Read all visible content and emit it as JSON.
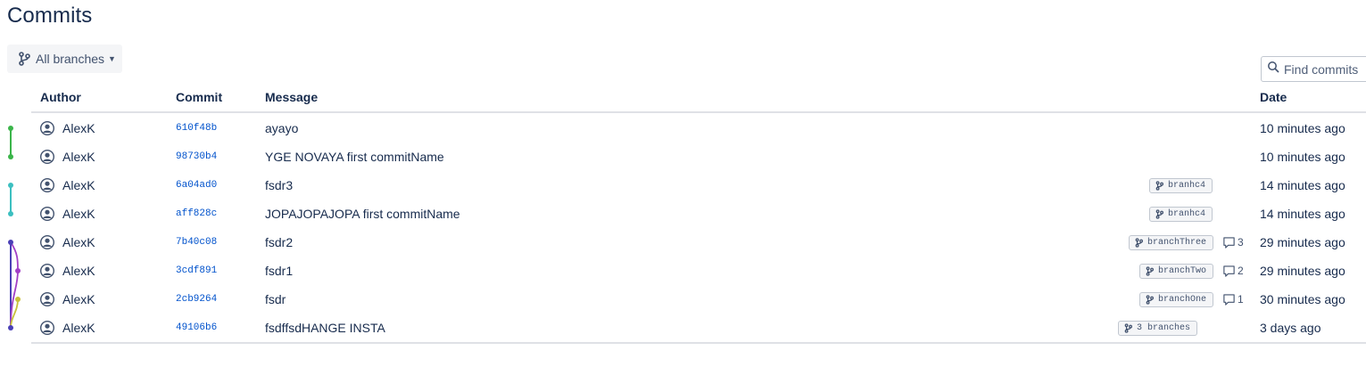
{
  "page": {
    "title": "Commits"
  },
  "toolbar": {
    "branch_selector": "All branches",
    "search_placeholder": "Find commits"
  },
  "table": {
    "headers": {
      "author": "Author",
      "commit": "Commit",
      "message": "Message",
      "date": "Date"
    },
    "rows": [
      {
        "author": "AlexK",
        "hash": "610f48b",
        "message": "ayayo",
        "tag": "",
        "comments": "",
        "date": "10 minutes ago"
      },
      {
        "author": "AlexK",
        "hash": "98730b4",
        "message": "YGE NOVAYA first commitName",
        "tag": "",
        "comments": "",
        "date": "10 minutes ago"
      },
      {
        "author": "AlexK",
        "hash": "6a04ad0",
        "message": "fsdr3",
        "tag": "branhc4",
        "comments": "",
        "date": "14 minutes ago"
      },
      {
        "author": "AlexK",
        "hash": "aff828c",
        "message": "JOPAJOPAJOPA first commitName",
        "tag": "branhc4",
        "comments": "",
        "date": "14 minutes ago"
      },
      {
        "author": "AlexK",
        "hash": "7b40c08",
        "message": "fsdr2",
        "tag": "branchThree",
        "comments": "3",
        "date": "29 minutes ago"
      },
      {
        "author": "AlexK",
        "hash": "3cdf891",
        "message": "fsdr1",
        "tag": "branchTwo",
        "comments": "2",
        "date": "29 minutes ago"
      },
      {
        "author": "AlexK",
        "hash": "2cb9264",
        "message": "fsdr",
        "tag": "branchOne",
        "comments": "1",
        "date": "30 minutes ago"
      },
      {
        "author": "AlexK",
        "hash": "49106b6",
        "message": "fsdffsdHANGE INSTA",
        "tag": "3 branches",
        "comments": "",
        "date": "3 days ago"
      }
    ]
  },
  "graph": {
    "colors": {
      "green": "#3bb54a",
      "teal": "#3cbfc0",
      "indigo": "#4a3fb6",
      "purple": "#a23fc6",
      "olive": "#c8c03a"
    }
  }
}
